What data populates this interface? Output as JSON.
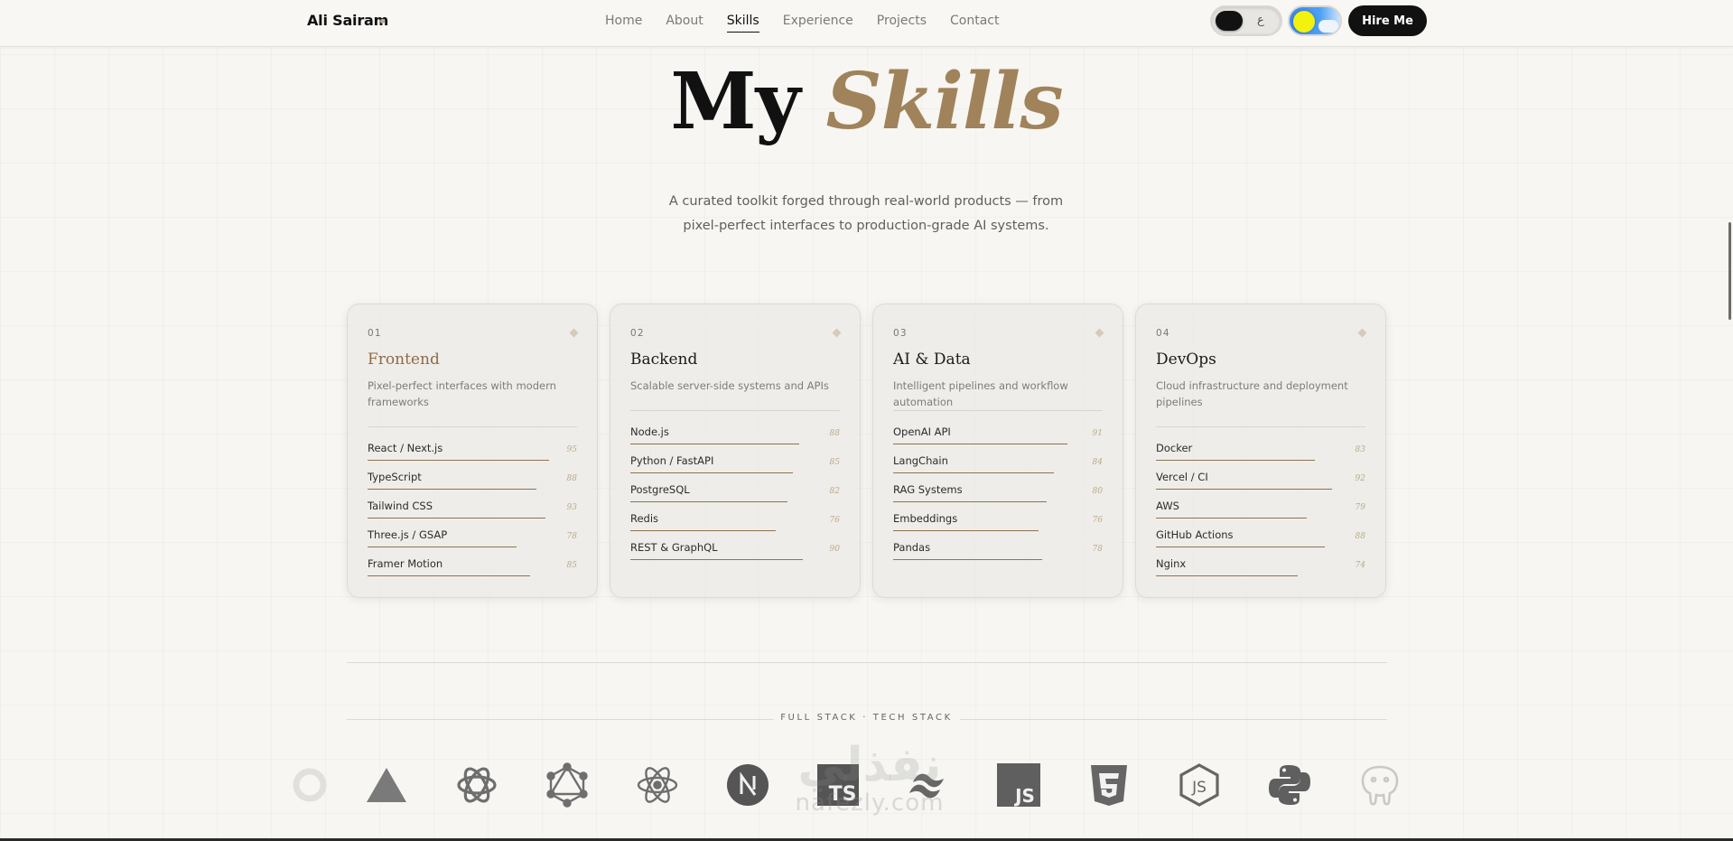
{
  "header": {
    "brand": "Ali Sairam",
    "nav": [
      "Home",
      "About",
      "Skills",
      "Experience",
      "Projects",
      "Contact"
    ],
    "active_nav": "Skills",
    "lang_glyph": "ع",
    "hire_label": "Hire Me"
  },
  "hero": {
    "title_main": "My",
    "title_accent": "Skills",
    "subtitle_line1": "A curated toolkit forged through real-world products — from",
    "subtitle_line2": "pixel-perfect interfaces to production-grade AI systems."
  },
  "cards": [
    {
      "num": "01",
      "title": "Frontend",
      "desc": "Pixel-perfect interfaces with modern frameworks",
      "skills": [
        {
          "name": "React / Next.js",
          "value": 95
        },
        {
          "name": "TypeScript",
          "value": 88
        },
        {
          "name": "Tailwind CSS",
          "value": 93
        },
        {
          "name": "Three.js / GSAP",
          "value": 78
        },
        {
          "name": "Framer Motion",
          "value": 85
        }
      ]
    },
    {
      "num": "02",
      "title": "Backend",
      "desc": "Scalable server-side systems and APIs",
      "skills": [
        {
          "name": "Node.js",
          "value": 88
        },
        {
          "name": "Python / FastAPI",
          "value": 85
        },
        {
          "name": "PostgreSQL",
          "value": 82
        },
        {
          "name": "Redis",
          "value": 76
        },
        {
          "name": "REST & GraphQL",
          "value": 90
        }
      ]
    },
    {
      "num": "03",
      "title": "AI & Data",
      "desc": "Intelligent pipelines and workflow automation",
      "skills": [
        {
          "name": "OpenAI API",
          "value": 91
        },
        {
          "name": "LangChain",
          "value": 84
        },
        {
          "name": "RAG Systems",
          "value": 80
        },
        {
          "name": "Embeddings",
          "value": 76
        },
        {
          "name": "Pandas",
          "value": 78
        }
      ]
    },
    {
      "num": "04",
      "title": "DevOps",
      "desc": "Cloud infrastructure and deployment pipelines",
      "skills": [
        {
          "name": "Docker",
          "value": 83
        },
        {
          "name": "Vercel / CI",
          "value": 92
        },
        {
          "name": "AWS",
          "value": 79
        },
        {
          "name": "GitHub Actions",
          "value": 88
        },
        {
          "name": "Nginx",
          "value": 74
        }
      ]
    }
  ],
  "stack": {
    "label": "FULL STACK · TECH STACK",
    "logos": [
      "ring-icon",
      "vercel-icon",
      "openai-icon",
      "graphql-icon",
      "react-icon",
      "nextjs-icon",
      "typescript-icon",
      "tailwind-icon",
      "javascript-icon",
      "html5-icon",
      "nodejs-icon",
      "python-icon",
      "postgresql-icon"
    ]
  },
  "watermark": {
    "ar": "نفذلي",
    "en": "nafezly.com"
  },
  "colors": {
    "accent": "#a0835a",
    "background": "#f7f6f2",
    "dark": "#111111",
    "logo_gray": "#6b6b6b"
  }
}
